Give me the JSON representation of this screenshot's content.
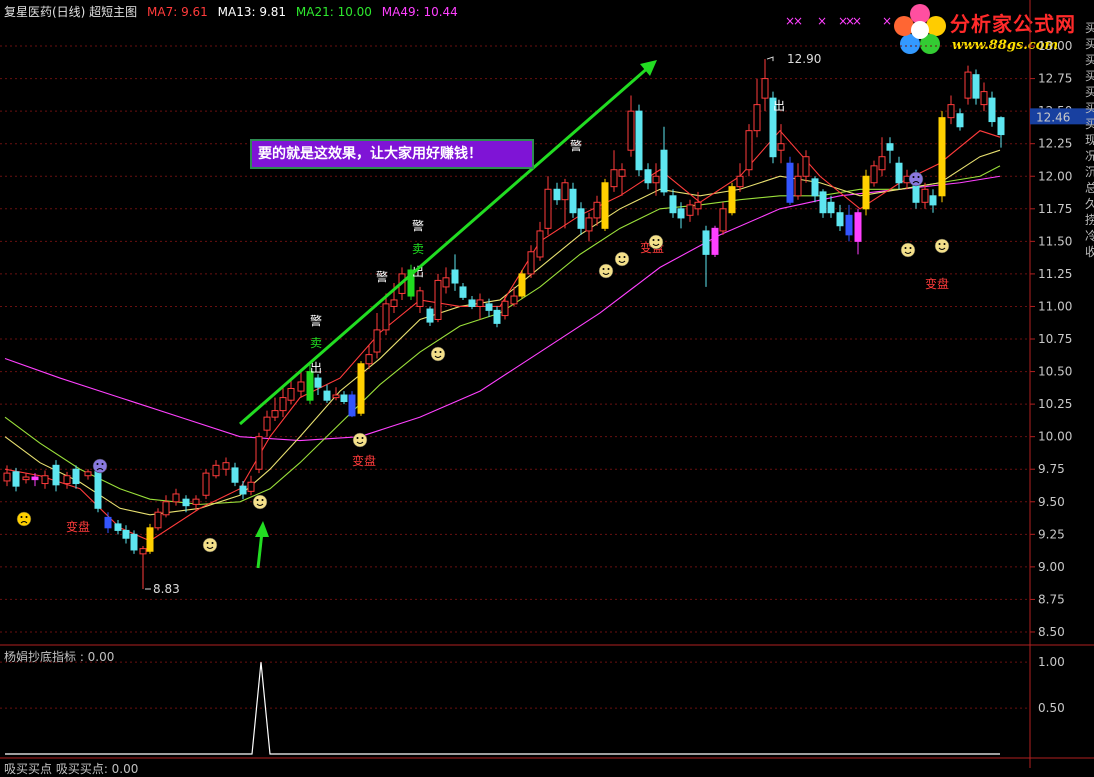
{
  "header": {
    "title": "复星医药(日线) 超短主图",
    "ma7_label": "MA7: 9.61",
    "ma13_label": "MA13: 9.81",
    "ma21_label": "MA21: 10.00",
    "ma49_label": "MA49: 10.44",
    "colors": {
      "ma7": "#ff3b3b",
      "ma13": "#ffffff",
      "ma21": "#2ee82e",
      "ma49": "#ff40ff"
    }
  },
  "sub_header": {
    "indicator_label": "杨娟抄底指标 : 0.00",
    "bottom_label": "吸买买点 吸买买点: 0.00"
  },
  "logo": {
    "name": "分析家公式网",
    "url": "www.88gs.com"
  },
  "callout": {
    "text": "要的就是这效果，让大家用好赚钱！"
  },
  "price_badge": {
    "value": "12.46"
  },
  "right_column_chars": [
    "买",
    "买",
    "买",
    "买",
    "买",
    "买",
    "买",
    "现",
    "况",
    "沉",
    "总",
    "久",
    "捞",
    "冷",
    "收"
  ],
  "annotations": {
    "high_label": "12.90",
    "low_label": "8.83",
    "jing": "警",
    "mai": "卖",
    "chu": "出",
    "bianpan": "变盘"
  },
  "chart_data": [
    {
      "type": "candlestick",
      "title": "复星医药(日线)",
      "ylim": [
        8.4,
        13.2
      ],
      "yticks": [
        "8.50",
        "8.75",
        "9.00",
        "9.25",
        "9.50",
        "9.75",
        "10.00",
        "10.25",
        "10.50",
        "10.75",
        "11.00",
        "11.25",
        "11.50",
        "11.75",
        "12.00",
        "12.25",
        "12.50",
        "12.75",
        "13.00"
      ],
      "annotated_high": 12.9,
      "annotated_low": 8.83,
      "last_price": 12.46,
      "grid": true,
      "series_ma": [
        "MA7",
        "MA13",
        "MA21",
        "MA49"
      ]
    },
    {
      "type": "line",
      "title": "杨娟抄底指标",
      "ylim": [
        0,
        1.1
      ],
      "yticks": [
        "0.50",
        "1.00"
      ],
      "spike_value": 1.0
    }
  ]
}
